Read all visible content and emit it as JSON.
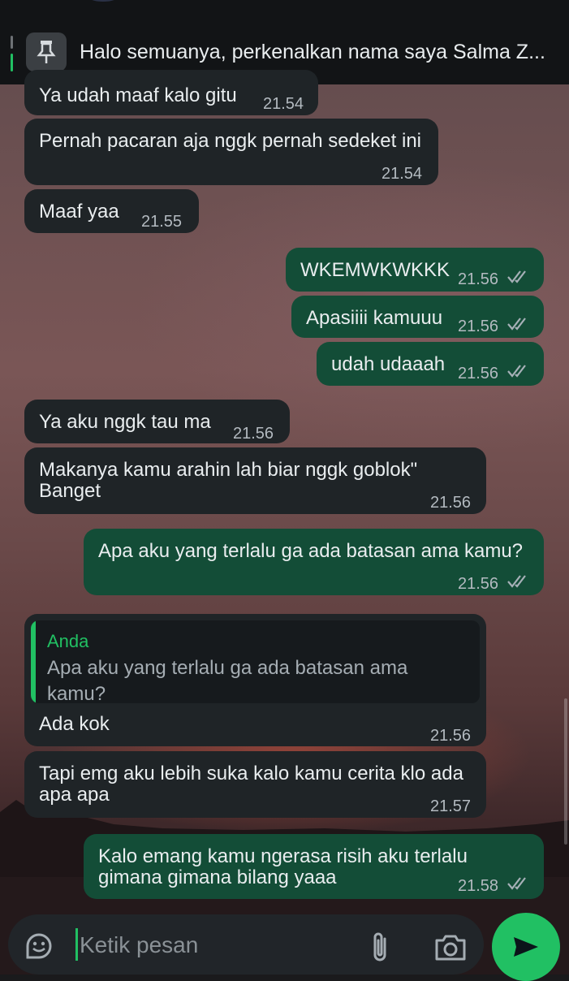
{
  "pinned": {
    "text": "Halo semuanya, perkenalkan nama saya Salma Z...",
    "icon": "pin-icon"
  },
  "messages": [
    {
      "dir": "in",
      "text": "Ya udah maaf kalo gitu",
      "time": "21.54"
    },
    {
      "dir": "in",
      "text": "Pernah pacaran aja nggk pernah sedeket ini",
      "time": "21.54"
    },
    {
      "dir": "in",
      "text": "Maaf yaa",
      "time": "21.55"
    },
    {
      "dir": "out",
      "text": "WKEMWKWKKK",
      "time": "21.56",
      "read": true
    },
    {
      "dir": "out",
      "text": "Apasiiii kamuuu",
      "time": "21.56",
      "read": true
    },
    {
      "dir": "out",
      "text": "udah udaaah",
      "time": "21.56",
      "read": true
    },
    {
      "dir": "in",
      "text": "Ya aku nggk tau ma",
      "time": "21.56"
    },
    {
      "dir": "in",
      "line1": "Makanya kamu arahin lah biar nggk goblok\"",
      "line2": "Banget",
      "time": "21.56"
    },
    {
      "dir": "out",
      "text": "Apa aku yang terlalu ga ada batasan ama kamu?",
      "time": "21.56",
      "read": true
    },
    {
      "dir": "in",
      "reply_author": "Anda",
      "reply_line1": "Apa aku yang terlalu ga ada batasan ama",
      "reply_line2": "kamu?",
      "text": "Ada kok",
      "time": "21.56"
    },
    {
      "dir": "in",
      "line1": "Tapi emg aku lebih suka kalo kamu cerita klo ada",
      "line2": "apa apa",
      "time": "21.57"
    },
    {
      "dir": "out",
      "line1": "Kalo emang kamu ngerasa risih aku terlalu",
      "line2": "gimana gimana bilang yaaa",
      "time": "21.58",
      "read": true
    }
  ],
  "composer": {
    "placeholder": "Ketik pesan",
    "icons": [
      "sticker-icon",
      "attach-icon",
      "camera-icon",
      "send-icon"
    ]
  },
  "colors": {
    "incoming_bubble": "#1f2427",
    "outgoing_bubble": "#134d37",
    "accent": "#21c063",
    "read_ticks": "#a6b0b7"
  }
}
